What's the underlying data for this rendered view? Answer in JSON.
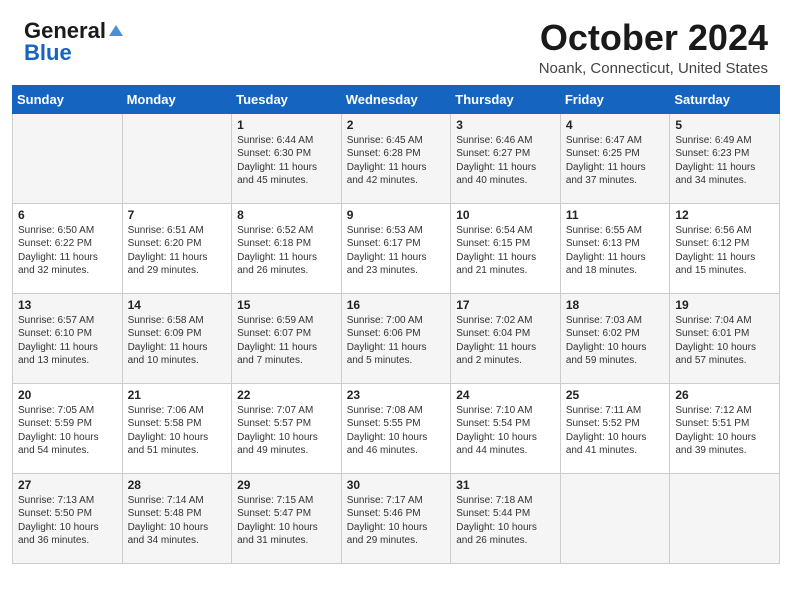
{
  "logo": {
    "line1": "General",
    "line2": "Blue"
  },
  "header": {
    "month": "October 2024",
    "location": "Noank, Connecticut, United States"
  },
  "days_of_week": [
    "Sunday",
    "Monday",
    "Tuesday",
    "Wednesday",
    "Thursday",
    "Friday",
    "Saturday"
  ],
  "weeks": [
    [
      {
        "day": "",
        "sunrise": "",
        "sunset": "",
        "daylight": ""
      },
      {
        "day": "",
        "sunrise": "",
        "sunset": "",
        "daylight": ""
      },
      {
        "day": "1",
        "sunrise": "Sunrise: 6:44 AM",
        "sunset": "Sunset: 6:30 PM",
        "daylight": "Daylight: 11 hours and 45 minutes."
      },
      {
        "day": "2",
        "sunrise": "Sunrise: 6:45 AM",
        "sunset": "Sunset: 6:28 PM",
        "daylight": "Daylight: 11 hours and 42 minutes."
      },
      {
        "day": "3",
        "sunrise": "Sunrise: 6:46 AM",
        "sunset": "Sunset: 6:27 PM",
        "daylight": "Daylight: 11 hours and 40 minutes."
      },
      {
        "day": "4",
        "sunrise": "Sunrise: 6:47 AM",
        "sunset": "Sunset: 6:25 PM",
        "daylight": "Daylight: 11 hours and 37 minutes."
      },
      {
        "day": "5",
        "sunrise": "Sunrise: 6:49 AM",
        "sunset": "Sunset: 6:23 PM",
        "daylight": "Daylight: 11 hours and 34 minutes."
      }
    ],
    [
      {
        "day": "6",
        "sunrise": "Sunrise: 6:50 AM",
        "sunset": "Sunset: 6:22 PM",
        "daylight": "Daylight: 11 hours and 32 minutes."
      },
      {
        "day": "7",
        "sunrise": "Sunrise: 6:51 AM",
        "sunset": "Sunset: 6:20 PM",
        "daylight": "Daylight: 11 hours and 29 minutes."
      },
      {
        "day": "8",
        "sunrise": "Sunrise: 6:52 AM",
        "sunset": "Sunset: 6:18 PM",
        "daylight": "Daylight: 11 hours and 26 minutes."
      },
      {
        "day": "9",
        "sunrise": "Sunrise: 6:53 AM",
        "sunset": "Sunset: 6:17 PM",
        "daylight": "Daylight: 11 hours and 23 minutes."
      },
      {
        "day": "10",
        "sunrise": "Sunrise: 6:54 AM",
        "sunset": "Sunset: 6:15 PM",
        "daylight": "Daylight: 11 hours and 21 minutes."
      },
      {
        "day": "11",
        "sunrise": "Sunrise: 6:55 AM",
        "sunset": "Sunset: 6:13 PM",
        "daylight": "Daylight: 11 hours and 18 minutes."
      },
      {
        "day": "12",
        "sunrise": "Sunrise: 6:56 AM",
        "sunset": "Sunset: 6:12 PM",
        "daylight": "Daylight: 11 hours and 15 minutes."
      }
    ],
    [
      {
        "day": "13",
        "sunrise": "Sunrise: 6:57 AM",
        "sunset": "Sunset: 6:10 PM",
        "daylight": "Daylight: 11 hours and 13 minutes."
      },
      {
        "day": "14",
        "sunrise": "Sunrise: 6:58 AM",
        "sunset": "Sunset: 6:09 PM",
        "daylight": "Daylight: 11 hours and 10 minutes."
      },
      {
        "day": "15",
        "sunrise": "Sunrise: 6:59 AM",
        "sunset": "Sunset: 6:07 PM",
        "daylight": "Daylight: 11 hours and 7 minutes."
      },
      {
        "day": "16",
        "sunrise": "Sunrise: 7:00 AM",
        "sunset": "Sunset: 6:06 PM",
        "daylight": "Daylight: 11 hours and 5 minutes."
      },
      {
        "day": "17",
        "sunrise": "Sunrise: 7:02 AM",
        "sunset": "Sunset: 6:04 PM",
        "daylight": "Daylight: 11 hours and 2 minutes."
      },
      {
        "day": "18",
        "sunrise": "Sunrise: 7:03 AM",
        "sunset": "Sunset: 6:02 PM",
        "daylight": "Daylight: 10 hours and 59 minutes."
      },
      {
        "day": "19",
        "sunrise": "Sunrise: 7:04 AM",
        "sunset": "Sunset: 6:01 PM",
        "daylight": "Daylight: 10 hours and 57 minutes."
      }
    ],
    [
      {
        "day": "20",
        "sunrise": "Sunrise: 7:05 AM",
        "sunset": "Sunset: 5:59 PM",
        "daylight": "Daylight: 10 hours and 54 minutes."
      },
      {
        "day": "21",
        "sunrise": "Sunrise: 7:06 AM",
        "sunset": "Sunset: 5:58 PM",
        "daylight": "Daylight: 10 hours and 51 minutes."
      },
      {
        "day": "22",
        "sunrise": "Sunrise: 7:07 AM",
        "sunset": "Sunset: 5:57 PM",
        "daylight": "Daylight: 10 hours and 49 minutes."
      },
      {
        "day": "23",
        "sunrise": "Sunrise: 7:08 AM",
        "sunset": "Sunset: 5:55 PM",
        "daylight": "Daylight: 10 hours and 46 minutes."
      },
      {
        "day": "24",
        "sunrise": "Sunrise: 7:10 AM",
        "sunset": "Sunset: 5:54 PM",
        "daylight": "Daylight: 10 hours and 44 minutes."
      },
      {
        "day": "25",
        "sunrise": "Sunrise: 7:11 AM",
        "sunset": "Sunset: 5:52 PM",
        "daylight": "Daylight: 10 hours and 41 minutes."
      },
      {
        "day": "26",
        "sunrise": "Sunrise: 7:12 AM",
        "sunset": "Sunset: 5:51 PM",
        "daylight": "Daylight: 10 hours and 39 minutes."
      }
    ],
    [
      {
        "day": "27",
        "sunrise": "Sunrise: 7:13 AM",
        "sunset": "Sunset: 5:50 PM",
        "daylight": "Daylight: 10 hours and 36 minutes."
      },
      {
        "day": "28",
        "sunrise": "Sunrise: 7:14 AM",
        "sunset": "Sunset: 5:48 PM",
        "daylight": "Daylight: 10 hours and 34 minutes."
      },
      {
        "day": "29",
        "sunrise": "Sunrise: 7:15 AM",
        "sunset": "Sunset: 5:47 PM",
        "daylight": "Daylight: 10 hours and 31 minutes."
      },
      {
        "day": "30",
        "sunrise": "Sunrise: 7:17 AM",
        "sunset": "Sunset: 5:46 PM",
        "daylight": "Daylight: 10 hours and 29 minutes."
      },
      {
        "day": "31",
        "sunrise": "Sunrise: 7:18 AM",
        "sunset": "Sunset: 5:44 PM",
        "daylight": "Daylight: 10 hours and 26 minutes."
      },
      {
        "day": "",
        "sunrise": "",
        "sunset": "",
        "daylight": ""
      },
      {
        "day": "",
        "sunrise": "",
        "sunset": "",
        "daylight": ""
      }
    ]
  ]
}
